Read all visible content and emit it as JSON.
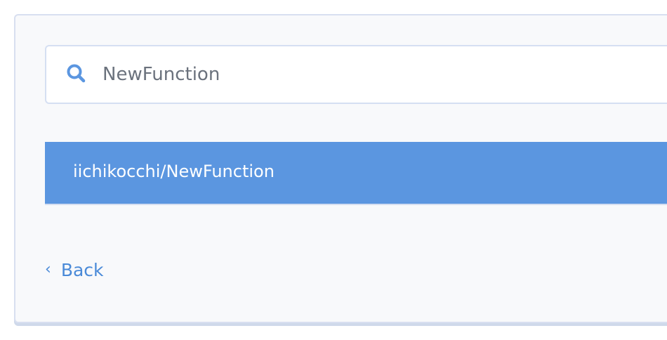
{
  "search": {
    "icon": "search-icon",
    "value": "NewFunction",
    "placeholder": ""
  },
  "results": [
    {
      "label": "iichikocchi/NewFunction",
      "selected": true
    }
  ],
  "navigation": {
    "back_icon": "chevron-left-icon",
    "back_label": "Back"
  },
  "colors": {
    "accent": "#5b96e0",
    "link": "#4a8ad8",
    "panel_bg": "#f8f9fb",
    "border": "#d5dff2"
  }
}
